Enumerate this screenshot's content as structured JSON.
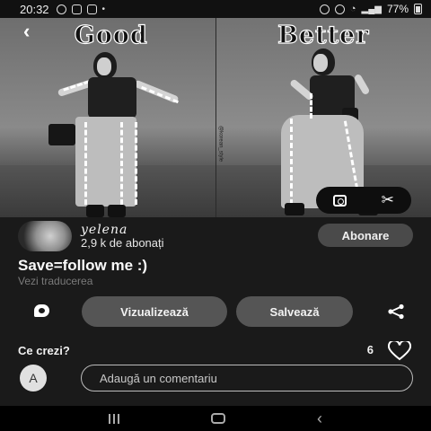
{
  "status_bar": {
    "time": "20:32",
    "battery": "77%"
  },
  "pin": {
    "image_captions": {
      "left": "Good",
      "right": "Better"
    },
    "title": "Save=follow me :)",
    "translate_link": "Vezi traducerea"
  },
  "creator": {
    "name": "yelena",
    "subscribers": "2,9 k de abonați",
    "follow_label": "Abonare"
  },
  "actions": {
    "view_label": "Vizualizează",
    "save_label": "Salvează"
  },
  "comments": {
    "prompt": "Ce crezi?",
    "likes": "6",
    "avatar_initial": "A",
    "input_placeholder": "Adaugă un comentariu"
  },
  "icons": {
    "back": "back-arrow-icon",
    "lens": "visual-search-icon",
    "crop": "scissors-icon",
    "comment": "comment-icon",
    "share": "share-icon",
    "like": "heart-icon"
  }
}
